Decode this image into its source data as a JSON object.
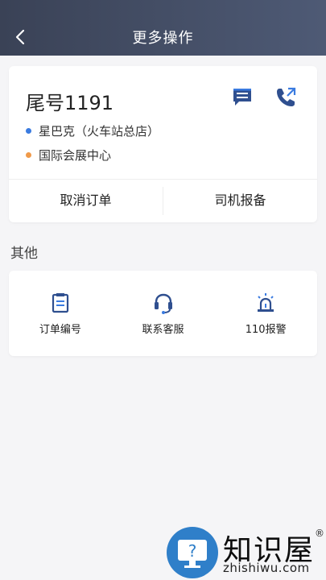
{
  "header": {
    "title": "更多操作",
    "back_icon": "chevron-left-icon"
  },
  "trip": {
    "plate": "尾号1191",
    "message_icon": "message-icon",
    "phone_icon": "phone-icon",
    "start": "星巴克（火车站总店）",
    "destination": "国际会展中心",
    "start_color": "#3a7be0",
    "destination_color": "#f09a4a",
    "actions": [
      {
        "label": "取消订单"
      },
      {
        "label": "司机报备"
      }
    ]
  },
  "other": {
    "title": "其他",
    "items": [
      {
        "label": "订单编号",
        "icon": "clipboard-icon"
      },
      {
        "label": "联系客服",
        "icon": "headset-icon"
      },
      {
        "label": "110报警",
        "icon": "alarm-light-icon"
      }
    ]
  },
  "watermark": {
    "brand": "知识屋",
    "reg": "®",
    "url": "zhishiwu.com"
  },
  "colors": {
    "accent": "#2f4f8f",
    "header": "#3a4256"
  }
}
